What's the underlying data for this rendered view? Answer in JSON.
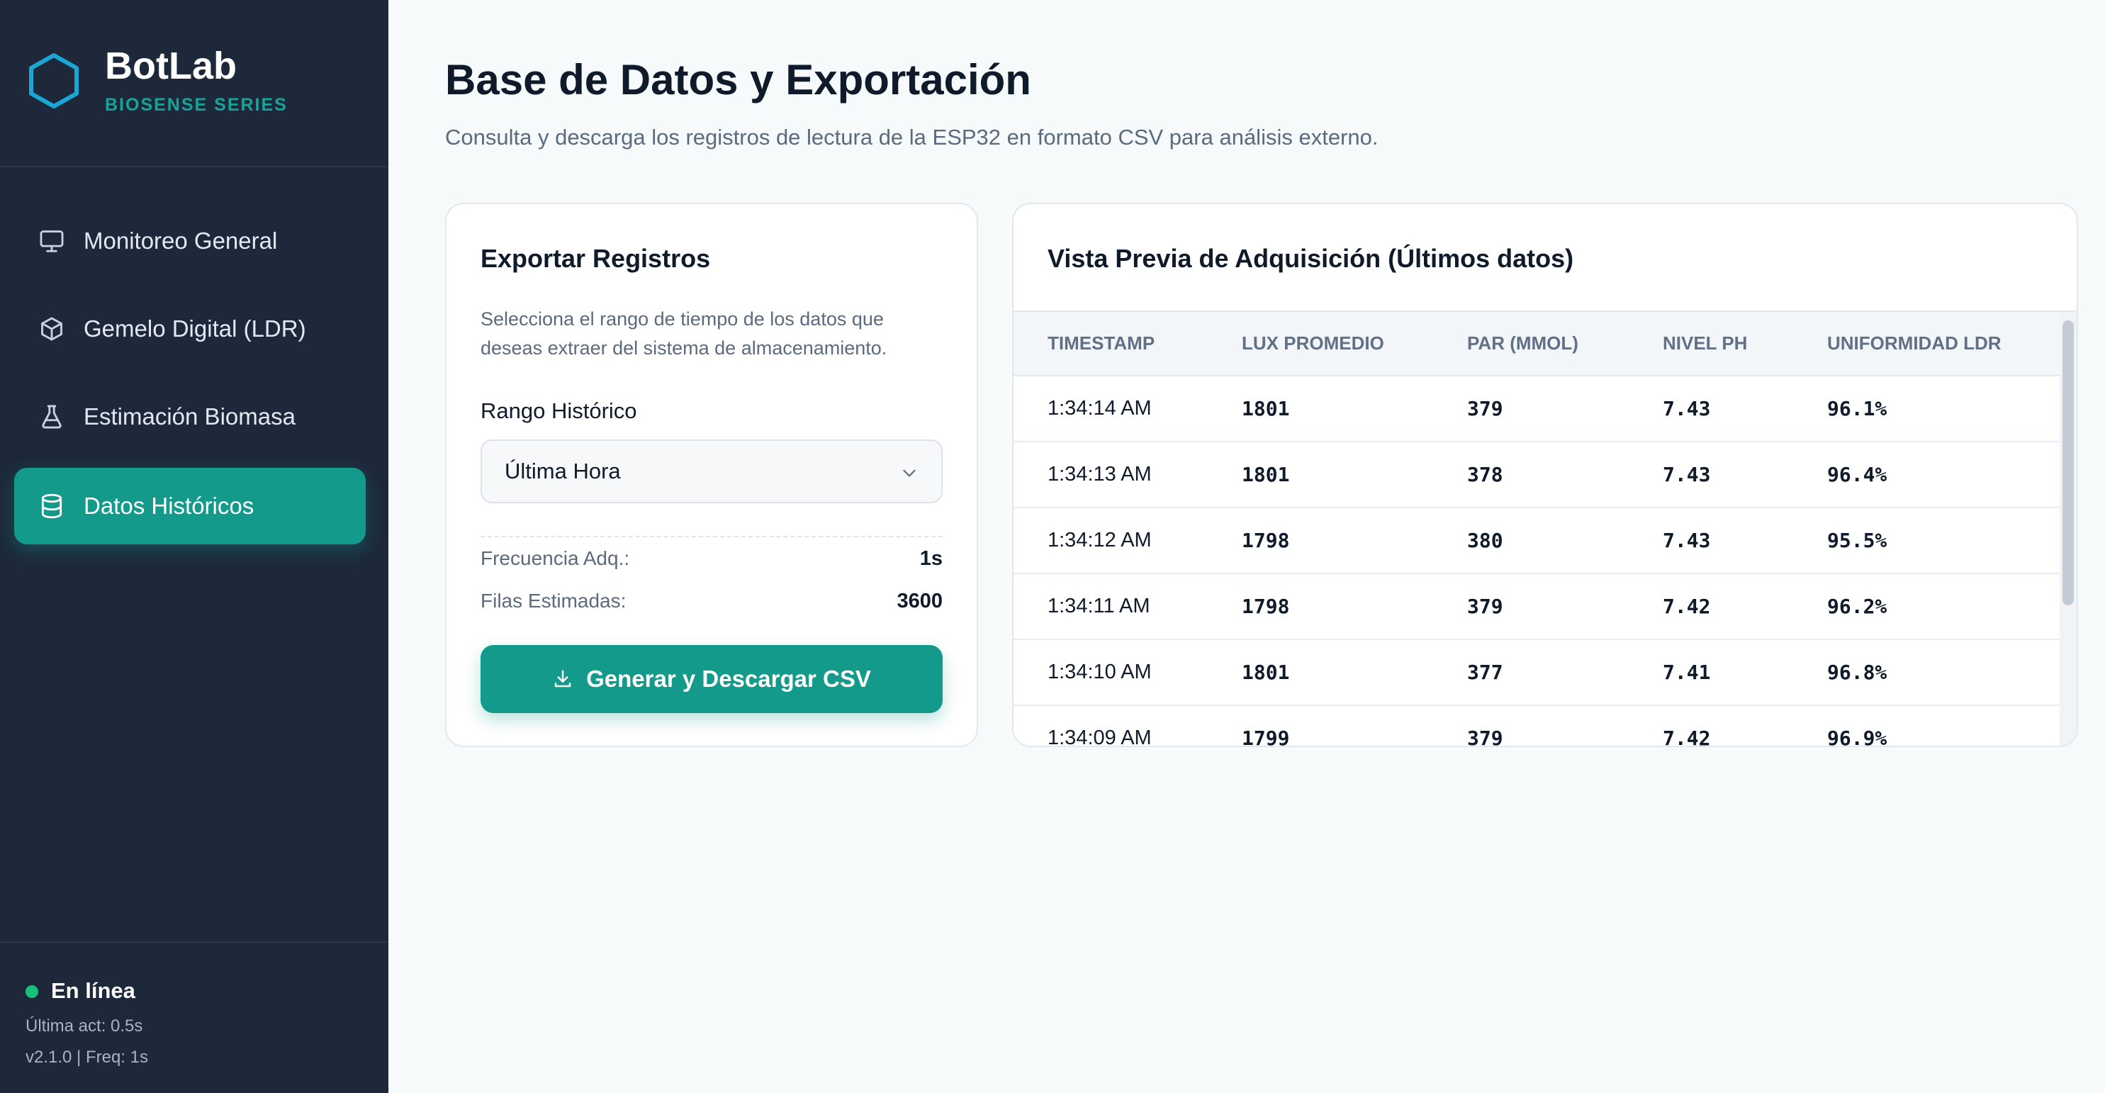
{
  "brand": {
    "name": "BotLab",
    "subtitle": "BIOSENSE SERIES"
  },
  "colors": {
    "sidebar_bg": "#1d293b",
    "accent": "#139a8a",
    "online": "#16c27a",
    "brand_icon": "#1aa7d6"
  },
  "sidebar": {
    "items": [
      {
        "label": "Monitoreo General",
        "icon": "monitor-icon",
        "active": false
      },
      {
        "label": "Gemelo Digital (LDR)",
        "icon": "cube-icon",
        "active": false
      },
      {
        "label": "Estimación Biomasa",
        "icon": "flask-icon",
        "active": false
      },
      {
        "label": "Datos Históricos",
        "icon": "database-icon",
        "active": true
      }
    ],
    "status": {
      "label": "En línea",
      "last_update": "Última act: 0.5s",
      "version": "v2.1.0 | Freq: 1s"
    }
  },
  "header": {
    "title": "Base de Datos y Exportación",
    "subtitle": "Consulta y descarga los registros de lectura de la ESP32 en formato CSV para análisis externo."
  },
  "export": {
    "title": "Exportar Registros",
    "description": "Selecciona el rango de tiempo de los datos que deseas extraer del sistema de almacenamiento.",
    "range_label": "Rango Histórico",
    "range_value": "Última Hora",
    "freq_label": "Frecuencia Adq.:",
    "freq_value": "1s",
    "rows_label": "Filas Estimadas:",
    "rows_value": "3600",
    "button_label": "Generar y Descargar CSV"
  },
  "preview": {
    "title": "Vista Previa de Adquisición (Últimos datos)",
    "columns": [
      "TIMESTAMP",
      "LUX PROMEDIO",
      "PAR (MMOL)",
      "NIVEL PH",
      "UNIFORMIDAD LDR"
    ],
    "rows": [
      [
        "1:34:14 AM",
        "1801",
        "379",
        "7.43",
        "96.1%"
      ],
      [
        "1:34:13 AM",
        "1801",
        "378",
        "7.43",
        "96.4%"
      ],
      [
        "1:34:12 AM",
        "1798",
        "380",
        "7.43",
        "95.5%"
      ],
      [
        "1:34:11 AM",
        "1798",
        "379",
        "7.42",
        "96.2%"
      ],
      [
        "1:34:10 AM",
        "1801",
        "377",
        "7.41",
        "96.8%"
      ],
      [
        "1:34:09 AM",
        "1799",
        "379",
        "7.42",
        "96.9%"
      ]
    ]
  }
}
